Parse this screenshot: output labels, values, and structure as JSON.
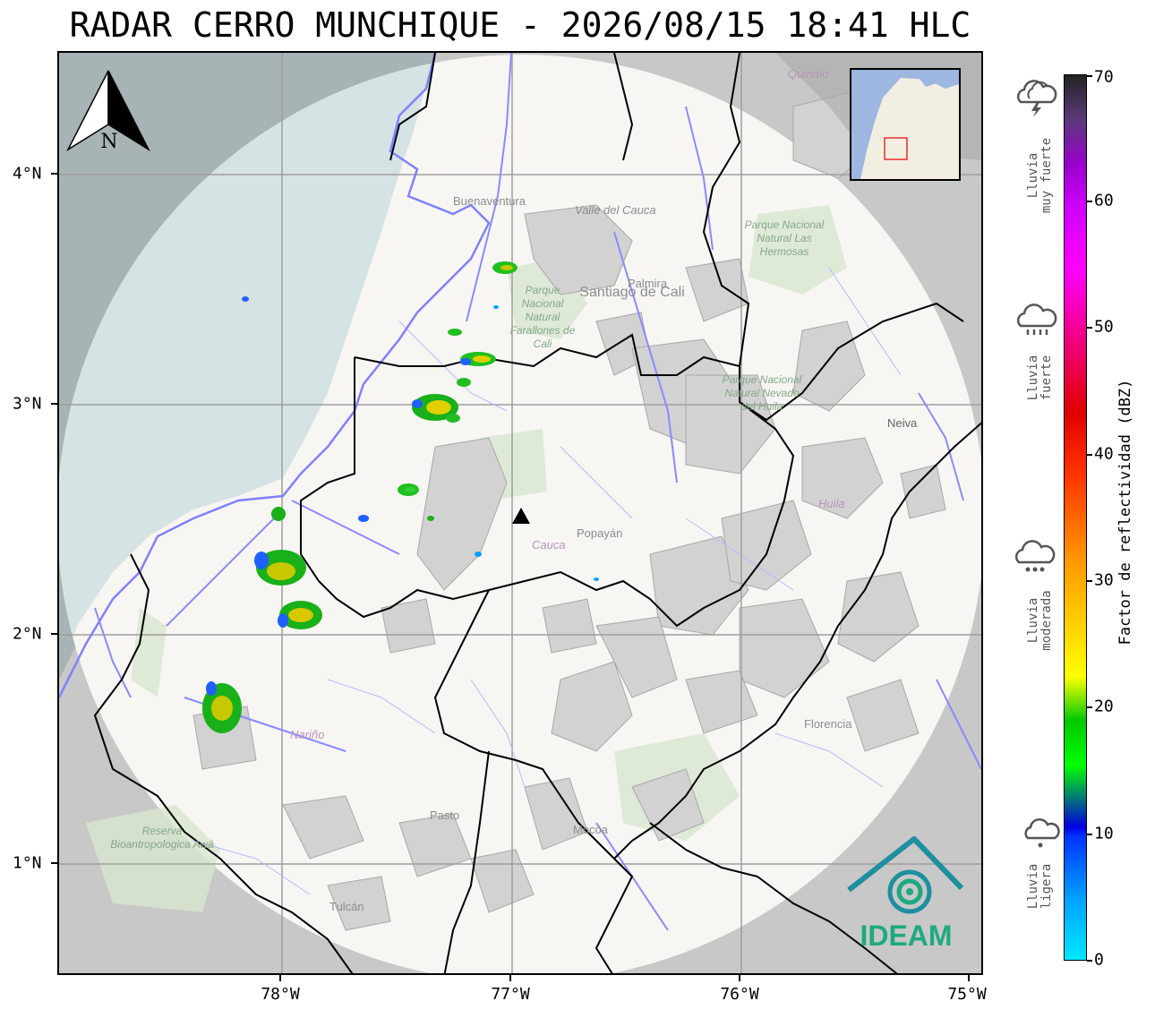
{
  "title": "RADAR CERRO MUNCHIQUE - 2026/08/15 18:41 HLC",
  "axes": {
    "x_ticks": [
      "78°W",
      "77°W",
      "76°W",
      "75°W"
    ],
    "y_ticks": [
      "4°N",
      "3°N",
      "2°N",
      "1°N"
    ]
  },
  "north_arrow": {
    "label": "N"
  },
  "map_labels": {
    "buenaventura": "Buenaventura",
    "valle_del_cauca": "Valle del Cauca",
    "parque_farallones": "Parque Nacional Natural Farallones de Cali",
    "santiago_de_cali": "Santiago de Cali",
    "palmira": "Palmira",
    "parque_hermosas": "Parque Nacional Natural Las Hermosas",
    "parque_nevado": "Parque Nacional Natural Nevado del Huila",
    "neiva": "Neiva",
    "huila": "Huila",
    "cauca": "Cauca",
    "popayan": "Popayán",
    "narino": "Nariño",
    "florencia": "Florencia",
    "pasto": "Pasto",
    "mocoa": "Mocoa",
    "reserva": "Reserva Bioantropologica Awá",
    "tulcan": "Tulcán",
    "quindio": "Quindío"
  },
  "logo": {
    "text": "IDEAM"
  },
  "colorbar": {
    "label": "Factor de reflectividad (dBZ)",
    "ticks": [
      "0",
      "10",
      "20",
      "30",
      "40",
      "50",
      "60",
      "70"
    ],
    "range": [
      0,
      70
    ]
  },
  "rain_categories": [
    {
      "line1": "Lluvia",
      "line2": "muy fuerte",
      "icon": "storm-cloud-icon"
    },
    {
      "line1": "Lluvia",
      "line2": "fuerte",
      "icon": "heavy-rain-cloud-icon"
    },
    {
      "line1": "Lluvia",
      "line2": "moderada",
      "icon": "moderate-rain-cloud-icon"
    },
    {
      "line1": "Lluvia",
      "line2": "ligera",
      "icon": "light-rain-cloud-icon"
    }
  ],
  "colors": {
    "radar_coverage": "#f7f6f3",
    "outside_coverage": "#c6c6c6",
    "ocean": "#d6e3e4",
    "rivers": "#8a8aff",
    "logo": "#1fa97f",
    "station_marker": "#000000"
  }
}
